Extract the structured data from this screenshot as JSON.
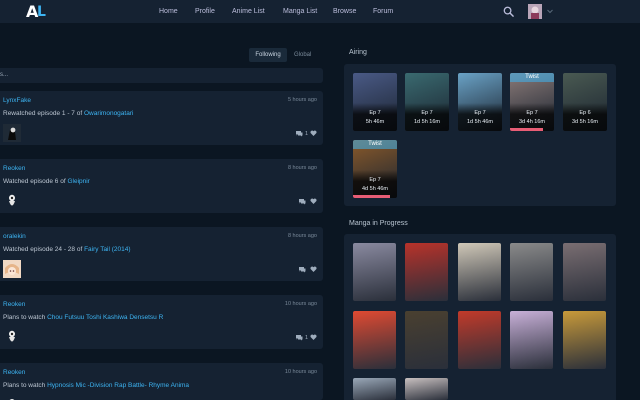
{
  "header": {
    "logo_a": "A",
    "logo_l": "L",
    "nav": [
      {
        "label": "Home"
      },
      {
        "label": "Profile"
      },
      {
        "label": "Anime List"
      },
      {
        "label": "Manga List"
      },
      {
        "label": "Browse"
      },
      {
        "label": "Forum"
      }
    ],
    "search_icon": "search-icon"
  },
  "feed": {
    "tabs": {
      "following": "Following",
      "global": "Global"
    },
    "status_placeholder": "s...",
    "activities": [
      {
        "user": "LynxFake",
        "time": "5 hours ago",
        "text": "Rewatched episode 1 - 7 of ",
        "media": "Owarimonogatari",
        "replies": "1",
        "likes": ""
      },
      {
        "user": "Reoken",
        "time": "8 hours ago",
        "text": "Watched episode 6 of ",
        "media": "Gleipnir",
        "replies": "",
        "likes": ""
      },
      {
        "user": "oralekin",
        "time": "8 hours ago",
        "text": "Watched episode 24 - 28 of ",
        "media": "Fairy Tail (2014)",
        "replies": "",
        "likes": ""
      },
      {
        "user": "Reoken",
        "time": "10 hours ago",
        "text": "Plans to watch ",
        "media": "Chou Futsuu Toshi Kashiwa Densetsu R",
        "replies": "1",
        "likes": ""
      },
      {
        "user": "Reoken",
        "time": "10 hours ago",
        "text": "Plans to watch ",
        "media": "Hypnosis Mic -Division Rap Battle- Rhyme Anima",
        "replies": "",
        "likes": ""
      }
    ]
  },
  "airing": {
    "title": "Airing",
    "items": [
      {
        "ep": "Ep 7",
        "countdown": "5h 46m",
        "badge": "",
        "progress": 0,
        "color": "#4a5a86"
      },
      {
        "ep": "Ep 7",
        "countdown": "1d 5h 16m",
        "badge": "",
        "progress": 0,
        "color": "#3a6a70"
      },
      {
        "ep": "Ep 7",
        "countdown": "1d 5h 46m",
        "badge": "",
        "progress": 0,
        "color": "#6aa2c6"
      },
      {
        "ep": "Ep 7",
        "countdown": "3d 4h 16m",
        "badge": "Twist",
        "progress": 0.75,
        "color": "#8a7a78"
      },
      {
        "ep": "Ep 6",
        "countdown": "3d 5h 16m",
        "badge": "",
        "progress": 0,
        "color": "#4a5a52"
      },
      {
        "ep": "Ep 7",
        "countdown": "4d 5h 46m",
        "badge": "Twist",
        "progress": 0.85,
        "color": "#8a5a2a"
      }
    ]
  },
  "manga": {
    "title": "Manga in Progress",
    "items": [
      {
        "color": "#8a8aa0"
      },
      {
        "color": "#b8322a"
      },
      {
        "color": "#d0c8b8"
      },
      {
        "color": "#8a8a8a"
      },
      {
        "color": "#7a6e72"
      },
      {
        "color": "#e04a32"
      },
      {
        "color": "#4a4030"
      },
      {
        "color": "#c23a2a"
      },
      {
        "color": "#c8b0d8"
      },
      {
        "color": "#c89a3a"
      },
      {
        "color": "#9aa8b8"
      },
      {
        "color": "#c8c0c0"
      }
    ]
  },
  "colors": {
    "accent": "#3db4f2",
    "bg": "#0b1622",
    "card": "#152232",
    "heart": "#e85d75"
  }
}
